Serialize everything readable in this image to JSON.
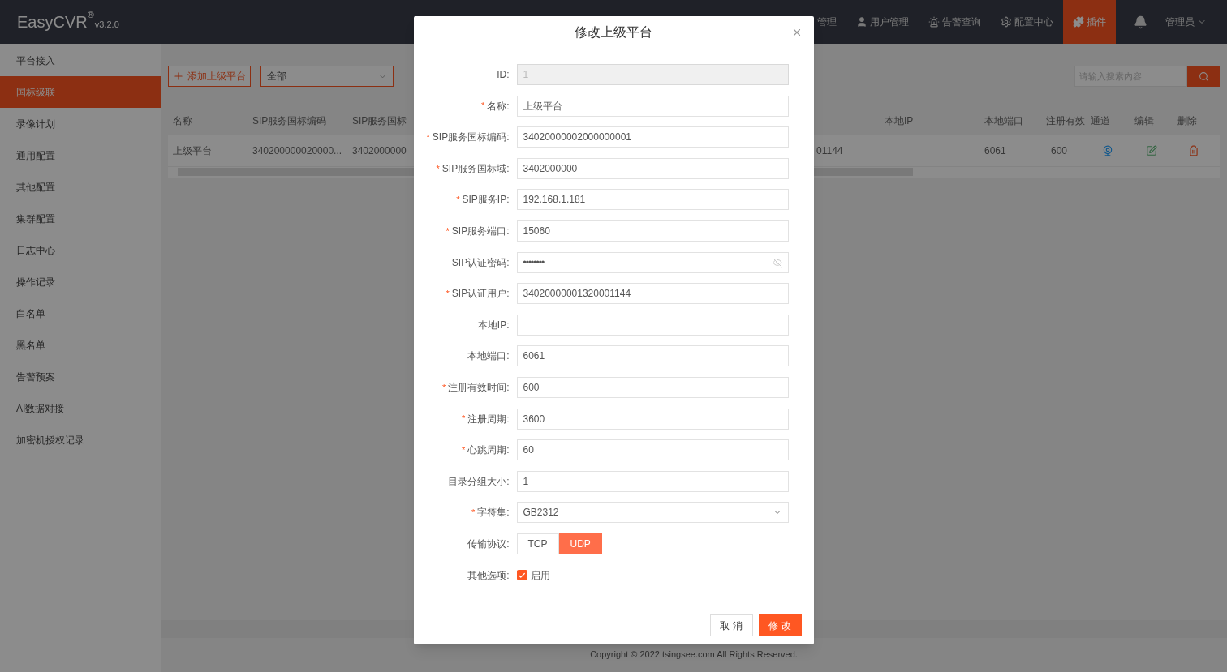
{
  "header": {
    "logo": "EasyCVR",
    "registered": "®",
    "version": "v3.2.0",
    "nav": [
      {
        "label": "管理",
        "selected": false
      },
      {
        "label": "用户管理",
        "selected": false
      },
      {
        "label": "告警查询",
        "selected": false
      },
      {
        "label": "配置中心",
        "selected": false
      },
      {
        "label": "插件",
        "selected": true
      }
    ],
    "user": "管理员"
  },
  "sidebar": {
    "items": [
      {
        "label": "平台接入",
        "selected": false
      },
      {
        "label": "国标级联",
        "selected": true
      },
      {
        "label": "录像计划",
        "selected": false
      },
      {
        "label": "通用配置",
        "selected": false
      },
      {
        "label": "其他配置",
        "selected": false
      },
      {
        "label": "集群配置",
        "selected": false
      },
      {
        "label": "日志中心",
        "selected": false
      },
      {
        "label": "操作记录",
        "selected": false
      },
      {
        "label": "白名单",
        "selected": false
      },
      {
        "label": "黑名单",
        "selected": false
      },
      {
        "label": "告警预案",
        "selected": false
      },
      {
        "label": "AI数据对接",
        "selected": false
      },
      {
        "label": "加密机授权记录",
        "selected": false
      }
    ]
  },
  "toolbar": {
    "add_button": "添加上级平台",
    "filter": "全部",
    "search": {
      "placeholder": "请输入搜索内容"
    }
  },
  "table": {
    "columns": {
      "name": "名称",
      "sip_code": "SIP服务国标编码",
      "sip_domain": "SIP服务国标",
      "local_ip": "本地IP",
      "local_port": "本地端口",
      "expiry": "注册有效",
      "channel": "通道",
      "edit": "编辑",
      "delete": "删除"
    },
    "rows": [
      {
        "name": "上级平台",
        "sip_code": "340200000020000...",
        "sip_domain": "3402000000",
        "column_4": "01144",
        "local_port": "6061",
        "expiry": "600"
      }
    ]
  },
  "dialog": {
    "title": "修改上级平台",
    "fields": [
      {
        "kind": "text",
        "label": "ID:",
        "disabled": true,
        "value": "1"
      },
      {
        "kind": "text",
        "required_mark": "*",
        "label": "名称:",
        "value": "上级平台"
      },
      {
        "kind": "text",
        "required_mark": "*",
        "label": "SIP服务国标编码:",
        "value": "34020000002000000001"
      },
      {
        "kind": "text",
        "required_mark": "*",
        "label": "SIP服务国标域:",
        "value": "3402000000"
      },
      {
        "kind": "text",
        "required_mark": "*",
        "label": "SIP服务IP:",
        "value": "192.168.1.181"
      },
      {
        "kind": "text",
        "required_mark": "*",
        "label": "SIP服务端口:",
        "value": "15060"
      },
      {
        "kind": "password",
        "label": "SIP认证密码:",
        "value": "••••••••"
      },
      {
        "kind": "text",
        "required_mark": "*",
        "label": "SIP认证用户:",
        "value": "34020000001320001144"
      },
      {
        "kind": "text",
        "label": "本地IP:"
      },
      {
        "kind": "text",
        "label": "本地端口:",
        "value": "6061"
      },
      {
        "kind": "text",
        "required_mark": "*",
        "label": "注册有效时间:",
        "value": "600"
      },
      {
        "kind": "text",
        "required_mark": "*",
        "label": "注册周期:",
        "value": "3600"
      },
      {
        "kind": "text",
        "required_mark": "*",
        "label": "心跳周期:",
        "value": "60"
      },
      {
        "kind": "text",
        "label": "目录分组大小:",
        "value": "1"
      },
      {
        "kind": "select",
        "required_mark": "*",
        "label": "字符集:",
        "value": "GB2312"
      },
      {
        "kind": "segmented",
        "label": "传输协议:",
        "options": [
          {
            "label": "TCP",
            "selected": false
          },
          {
            "label": "UDP",
            "selected": true
          }
        ]
      },
      {
        "kind": "checkbox",
        "label": "其他选项:",
        "checked": true,
        "text": "启用"
      }
    ],
    "buttons": {
      "cancel": "取 消",
      "confirm": "修 改"
    }
  },
  "footer": {
    "copyright": "Copyright © 2022 tsingsee.com All Rights Reserved."
  }
}
